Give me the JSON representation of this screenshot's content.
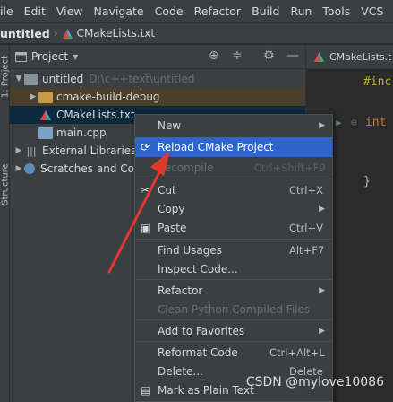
{
  "menubar": {
    "items": [
      "ile",
      "Edit",
      "View",
      "Navigate",
      "Code",
      "Refactor",
      "Build",
      "Run",
      "Tools",
      "VCS",
      "W"
    ]
  },
  "breadcrumb": {
    "project": "untitled",
    "file": "CMakeLists.txt"
  },
  "stripe": {
    "project_label": "1: Project",
    "structure_label": "Structure"
  },
  "project_panel": {
    "title": "Project",
    "tree": [
      {
        "label": "untitled",
        "path": "D:\\c++text\\untitled"
      },
      {
        "label": "cmake-build-debug"
      },
      {
        "label": "CMakeLists.txt"
      },
      {
        "label": "main.cpp"
      },
      {
        "label": "External Libraries"
      },
      {
        "label": "Scratches and Co"
      }
    ]
  },
  "editor": {
    "tab_label": "CMakeLists.t",
    "line1": "#inc",
    "line2": "int",
    "line3": "}"
  },
  "context_menu": {
    "items": [
      {
        "label": "New",
        "shortcut": ""
      },
      {
        "label": "Reload CMake Project",
        "shortcut": ""
      },
      {
        "label": "Recompile",
        "shortcut": "Ctrl+Shift+F9"
      },
      {
        "label": "Cut",
        "shortcut": "Ctrl+X"
      },
      {
        "label": "Copy",
        "shortcut": ""
      },
      {
        "label": "Paste",
        "shortcut": "Ctrl+V"
      },
      {
        "label": "Find Usages",
        "shortcut": "Alt+F7"
      },
      {
        "label": "Inspect Code...",
        "shortcut": ""
      },
      {
        "label": "Refactor",
        "shortcut": ""
      },
      {
        "label": "Clean Python Compiled Files",
        "shortcut": ""
      },
      {
        "label": "Add to Favorites",
        "shortcut": ""
      },
      {
        "label": "Reformat Code",
        "shortcut": "Ctrl+Alt+L"
      },
      {
        "label": "Delete...",
        "shortcut": "Delete"
      },
      {
        "label": "Mark as Plain Text",
        "shortcut": ""
      }
    ]
  },
  "watermark": "CSDN @mylove10086",
  "colors": {
    "menu_active": "#2f65ca",
    "annotation_arrow": "#e03a2f"
  }
}
